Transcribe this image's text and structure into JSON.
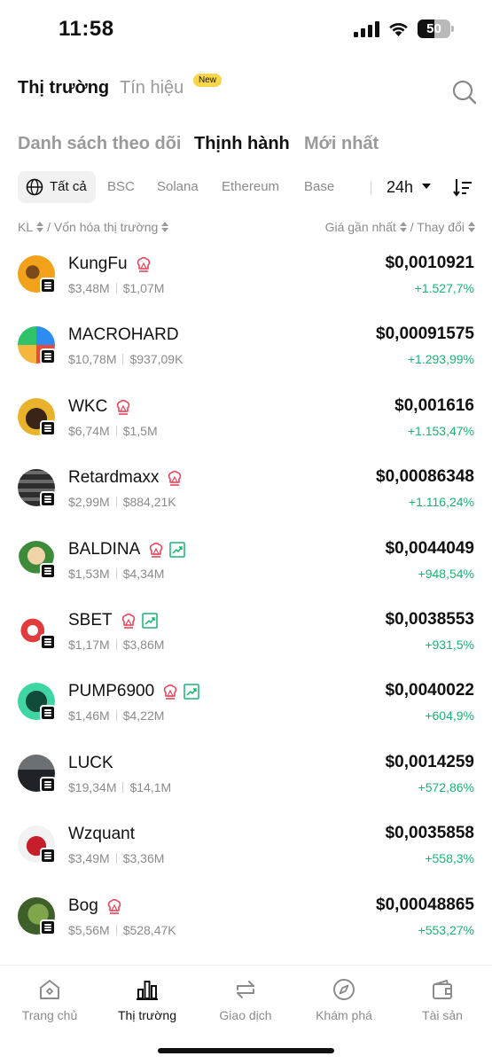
{
  "status_bar": {
    "time": "11:58",
    "battery": "50",
    "battery_level": 0.5
  },
  "top_tabs": [
    {
      "label": "Thị trường",
      "active": true
    },
    {
      "label": "Tín hiệu",
      "active": false,
      "badge": "New"
    }
  ],
  "sub_tabs": [
    {
      "label": "Danh sách theo dõi",
      "active": false
    },
    {
      "label": "Thịnh hành",
      "active": true
    },
    {
      "label": "Mới nhất",
      "active": false
    }
  ],
  "chains": [
    {
      "label": "Tất cả",
      "active": true,
      "icon": "globe-icon"
    },
    {
      "label": "BSC",
      "active": false
    },
    {
      "label": "Solana",
      "active": false
    },
    {
      "label": "Ethereum",
      "active": false
    },
    {
      "label": "Base",
      "active": false
    }
  ],
  "period": "24h",
  "list_header": {
    "left_a": "KL",
    "left_b": "/ Vốn hóa thị trường",
    "right_a": "Giá gần nhất",
    "right_b": "/ Thay đổi"
  },
  "tokens": [
    {
      "name": "KungFu",
      "volume": "$3,48M",
      "mcap": "$1,07M",
      "price": "$0,0010921",
      "change": "+1.527,7%",
      "flags": [
        "chef-icon"
      ]
    },
    {
      "name": "MACROHARD",
      "volume": "$10,78M",
      "mcap": "$937,09K",
      "price": "$0,00091575",
      "change": "+1.293,99%",
      "flags": []
    },
    {
      "name": "WKC",
      "volume": "$6,74M",
      "mcap": "$1,5M",
      "price": "$0,001616",
      "change": "+1.153,47%",
      "flags": [
        "chef-icon"
      ]
    },
    {
      "name": "Retardmaxx",
      "volume": "$2,99M",
      "mcap": "$884,21K",
      "price": "$0,00086348",
      "change": "+1.116,24%",
      "flags": [
        "chef-icon"
      ]
    },
    {
      "name": "BALDINA",
      "volume": "$1,53M",
      "mcap": "$4,34M",
      "price": "$0,0044049",
      "change": "+948,54%",
      "flags": [
        "chef-icon",
        "trending-icon"
      ]
    },
    {
      "name": "SBET",
      "volume": "$1,17M",
      "mcap": "$3,86M",
      "price": "$0,0038553",
      "change": "+931,5%",
      "flags": [
        "chef-icon",
        "trending-icon"
      ]
    },
    {
      "name": "PUMP6900",
      "volume": "$1,46M",
      "mcap": "$4,22M",
      "price": "$0,0040022",
      "change": "+604,9%",
      "flags": [
        "chef-icon",
        "trending-icon"
      ]
    },
    {
      "name": "LUCK",
      "volume": "$19,34M",
      "mcap": "$14,1M",
      "price": "$0,0014259",
      "change": "+572,86%",
      "flags": []
    },
    {
      "name": "Wzquant",
      "volume": "$3,49M",
      "mcap": "$3,36M",
      "price": "$0,0035858",
      "change": "+558,3%",
      "flags": []
    },
    {
      "name": "Bog",
      "volume": "$5,56M",
      "mcap": "$528,47K",
      "price": "$0,00048865",
      "change": "+553,27%",
      "flags": [
        "chef-icon"
      ]
    }
  ],
  "bottom_nav": [
    {
      "label": "Trang chủ",
      "icon": "home-icon",
      "active": false
    },
    {
      "label": "Thị trường",
      "icon": "market-icon",
      "active": true
    },
    {
      "label": "Giao dịch",
      "icon": "trade-icon",
      "active": false
    },
    {
      "label": "Khám phá",
      "icon": "compass-icon",
      "active": false
    },
    {
      "label": "Tài sản",
      "icon": "wallet-icon",
      "active": false
    }
  ],
  "colors": {
    "positive": "#16b574",
    "chef": "#e8455a",
    "trending": "#16b574",
    "badge": "#f9d648"
  }
}
